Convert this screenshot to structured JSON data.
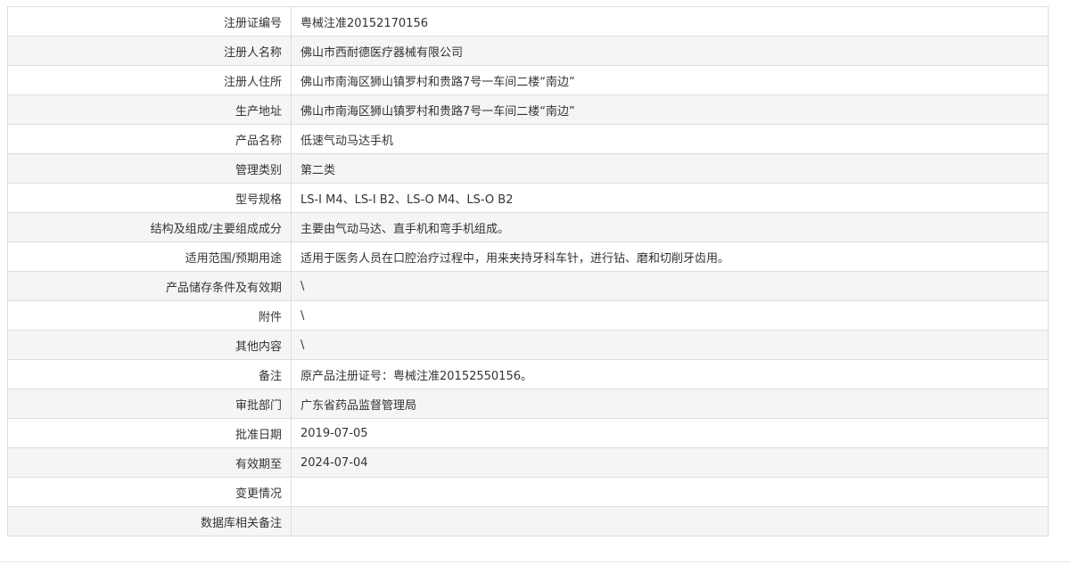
{
  "rows": [
    {
      "label": "注册证编号",
      "value": "粤械注准20152170156"
    },
    {
      "label": "注册人名称",
      "value": "佛山市西耐德医疗器械有限公司"
    },
    {
      "label": "注册人住所",
      "value": "佛山市南海区狮山镇罗村和贵路7号一车间二楼“南边”"
    },
    {
      "label": "生产地址",
      "value": "佛山市南海区狮山镇罗村和贵路7号一车间二楼“南边”"
    },
    {
      "label": "产品名称",
      "value": "低速气动马达手机"
    },
    {
      "label": "管理类别",
      "value": "第二类"
    },
    {
      "label": "型号规格",
      "value": "LS-I M4、LS-I B2、LS-O M4、LS-O B2"
    },
    {
      "label": "结构及组成/主要组成成分",
      "value": "主要由气动马达、直手机和弯手机组成。"
    },
    {
      "label": "适用范围/预期用途",
      "value": "适用于医务人员在口腔治疗过程中，用来夹持牙科车针，进行钻、磨和切削牙齿用。"
    },
    {
      "label": "产品储存条件及有效期",
      "value": "\\"
    },
    {
      "label": "附件",
      "value": "\\"
    },
    {
      "label": "其他内容",
      "value": "\\"
    },
    {
      "label": "备注",
      "value": "原产品注册证号：粤械注准20152550156。"
    },
    {
      "label": "审批部门",
      "value": "广东省药品监督管理局"
    },
    {
      "label": "批准日期",
      "value": "2019-07-05"
    },
    {
      "label": "有效期至",
      "value": "2024-07-04"
    },
    {
      "label": "变更情况",
      "value": ""
    },
    {
      "label": "数据库相关备注",
      "value": ""
    }
  ]
}
